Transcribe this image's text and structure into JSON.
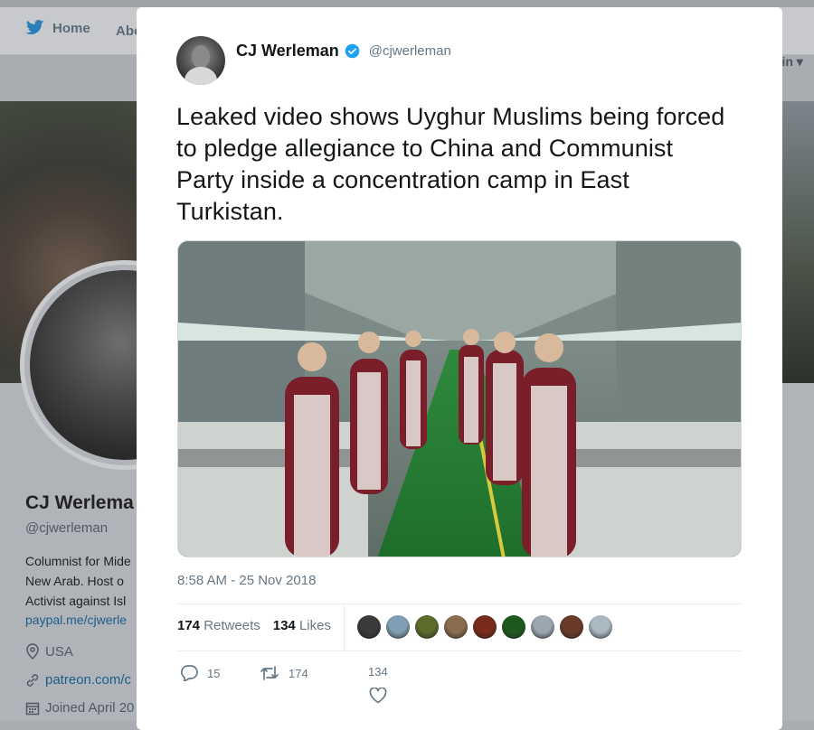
{
  "background": {
    "nav": {
      "home_label": "Home",
      "about_label": "Abo",
      "login_label": "g in"
    },
    "profile": {
      "name": "CJ Werlema",
      "handle": "@cjwerleman",
      "bio_lines": [
        "Columnist for Mide",
        "New Arab. Host o",
        "Activist against Isl"
      ],
      "link1": "paypal.me/cjwerle",
      "location": "USA",
      "link2": "patreon.com/c",
      "joined": "Joined April 20"
    }
  },
  "tweet": {
    "author_name": "CJ Werleman",
    "author_handle": "@cjwerleman",
    "verified": true,
    "text": "Leaked video shows Uyghur Muslims being forced to pledge allegiance to China and Communist Party inside a concentration camp in East Turkistan.",
    "timestamp": "8:58 AM - 25 Nov 2018",
    "retweets_count": "174",
    "retweets_label": "Retweets",
    "likes_count": "134",
    "likes_label": "Likes",
    "liker_avatars": [
      "#3a3a3a",
      "#7fa0b4",
      "#5d6b2c",
      "#8a6d4e",
      "#7a2b1c",
      "#1e5a1e",
      "#9aa6b0",
      "#6b3b2a",
      "#aab8c2"
    ],
    "actions": {
      "reply_count": "15",
      "retweet_count": "174",
      "like_count": "134"
    }
  },
  "colors": {
    "accent": "#1da1f2",
    "text": "#14171a",
    "muted": "#657786"
  }
}
